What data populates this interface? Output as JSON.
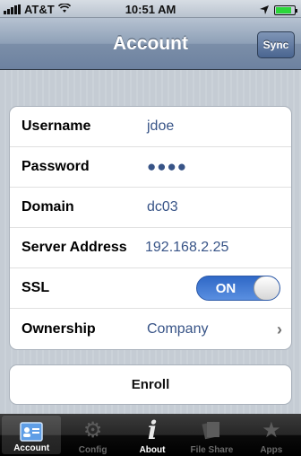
{
  "status": {
    "carrier": "AT&T",
    "time": "10:51 AM",
    "battery_level": 0.85
  },
  "nav": {
    "title": "Account",
    "sync_label": "Sync"
  },
  "fields": [
    {
      "label": "Username",
      "value": "jdoe"
    },
    {
      "label": "Password",
      "value": "●●●●"
    },
    {
      "label": "Domain",
      "value": "dc03"
    },
    {
      "label": "Server Address",
      "value": "192.168.2.25"
    },
    {
      "label": "SSL",
      "toggle": "ON"
    },
    {
      "label": "Ownership",
      "value": "Company"
    }
  ],
  "enroll_label": "Enroll",
  "tabs": [
    {
      "label": "Account",
      "icon": "account-icon",
      "selected": true
    },
    {
      "label": "Config",
      "icon": "gear-icon"
    },
    {
      "label": "About",
      "icon": "info-icon"
    },
    {
      "label": "File Share",
      "icon": "file-share-icon"
    },
    {
      "label": "Apps",
      "icon": "star-icon"
    }
  ],
  "colors": {
    "value_text": "#385487",
    "toggle_on": "#2f68c6",
    "nav_bar": "#7b8ea8"
  }
}
